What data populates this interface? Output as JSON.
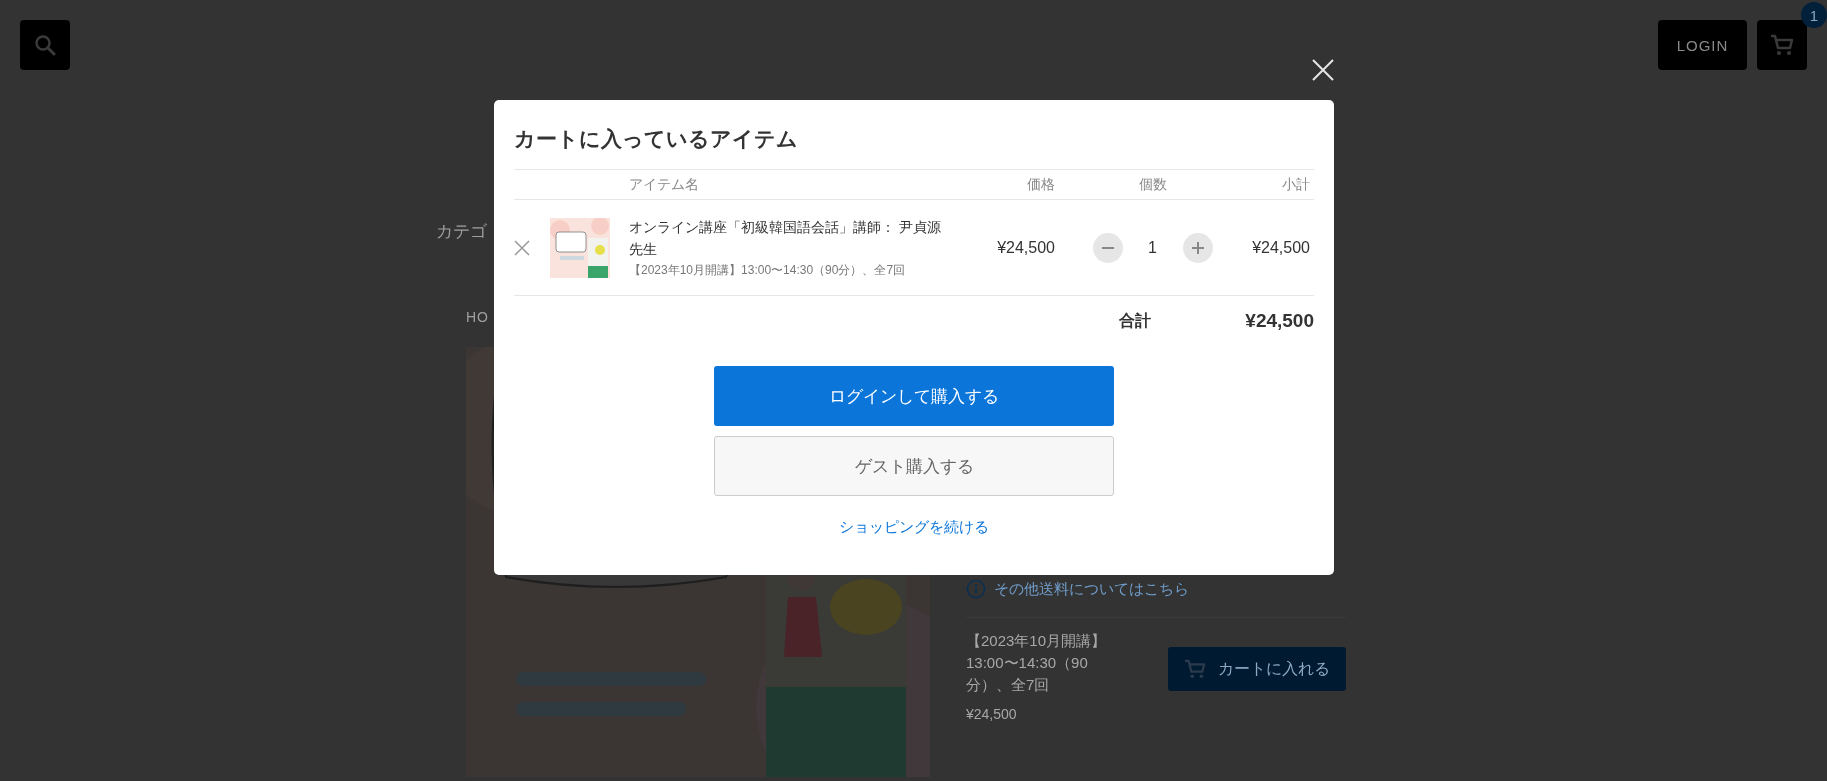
{
  "header": {
    "login_button": "LOGIN",
    "cart_count": "1"
  },
  "page": {
    "category_label": "カテゴ",
    "breadcrumb": "HO",
    "shipping_link": "その他送料についてはこちら",
    "option_text": "【2023年10月開講】13:00〜14:30（90分）、全7回",
    "price": "¥24,500",
    "add_to_cart": "カートに入れる"
  },
  "cart_modal": {
    "title": "カートに入っているアイテム",
    "columns": [
      "アイテム名",
      "価格",
      "個数",
      "小計"
    ],
    "items": [
      {
        "name": "オンライン講座「初級韓国語会話」講師： 尹貞源先生",
        "option": "【2023年10月開講】13:00〜14:30（90分）、全7回",
        "price": "¥24,500",
        "quantity": "1",
        "subtotal": "¥24,500"
      }
    ],
    "total_label": "合計",
    "total": "¥24,500",
    "login_purchase": "ログインして購入する",
    "guest_purchase": "ゲスト購入する",
    "continue_link": "ショッピングを続ける"
  }
}
